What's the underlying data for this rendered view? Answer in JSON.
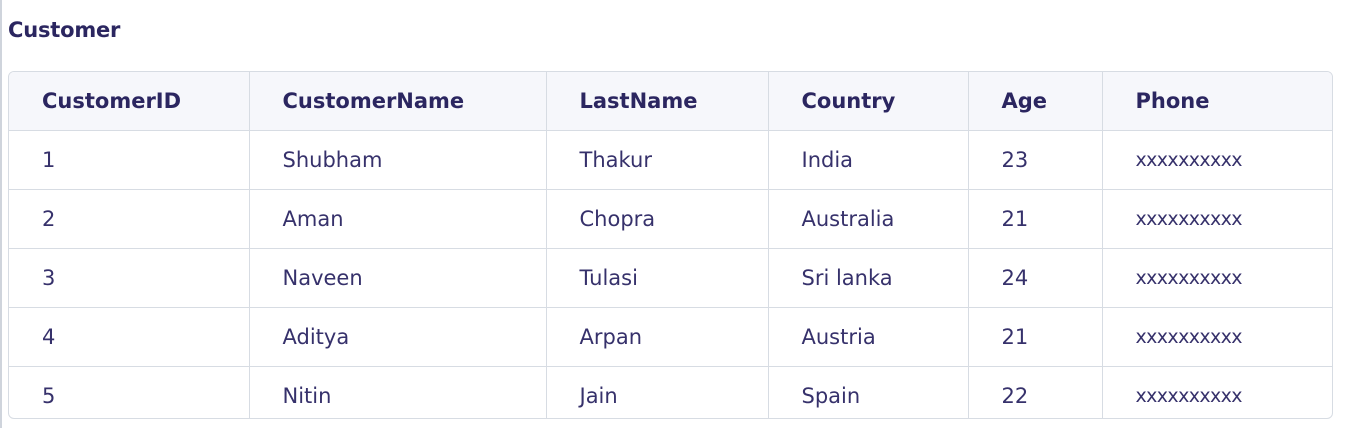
{
  "caption": "Customer",
  "table": {
    "headers": [
      "CustomerID",
      "CustomerName",
      "LastName",
      "Country",
      "Age",
      "Phone"
    ],
    "rows": [
      [
        "1",
        "Shubham",
        "Thakur",
        "India",
        "23",
        "xxxxxxxxxx"
      ],
      [
        "2",
        "Aman",
        "Chopra",
        "Australia",
        "21",
        "xxxxxxxxxx"
      ],
      [
        "3",
        "Naveen",
        "Tulasi",
        "Sri lanka",
        "24",
        "xxxxxxxxxx"
      ],
      [
        "4",
        "Aditya",
        "Arpan",
        "Austria",
        "21",
        "xxxxxxxxxx"
      ],
      [
        "5",
        "Nitin",
        "Jain",
        "Spain",
        "22",
        "xxxxxxxxxx"
      ]
    ]
  }
}
